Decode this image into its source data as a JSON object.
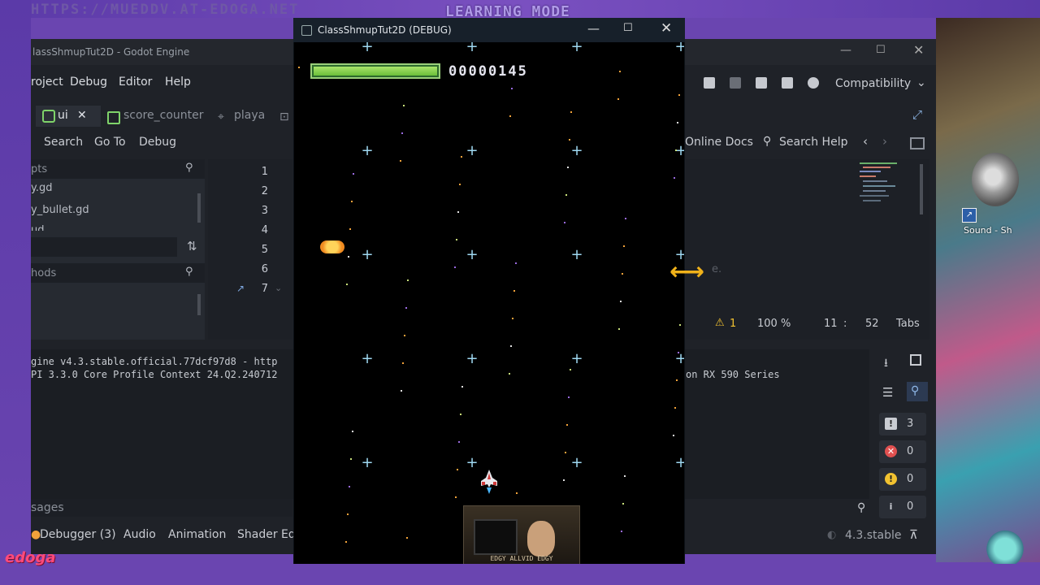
{
  "overlay": {
    "url_text": "HTTPS://MUEDDV.AT-EDOGA.NET",
    "mode_text": "LEARNING MODE",
    "logo_text": "edoga"
  },
  "desktop": {
    "icon_label": "Sound - Sh"
  },
  "editor": {
    "title": "lassShmupTut2D - Godot Engine",
    "menu": [
      "roject",
      "Debug",
      "Editor",
      "Help"
    ],
    "renderer": "Compatibility",
    "tabs": [
      {
        "label": "ui",
        "close": "✕"
      },
      {
        "label": "score_counter"
      },
      {
        "label": "playa"
      }
    ],
    "script_menu": [
      "Search",
      "Go To",
      "Debug"
    ],
    "docs": {
      "online": "Online Docs",
      "search_help": "Search Help"
    },
    "left_panel": {
      "filter1_placeholder": "pts",
      "files": [
        "y.gd",
        "y_bullet.gd",
        "ud"
      ],
      "filter2_placeholder": "hods"
    },
    "line_numbers": [
      "1",
      "2",
      "3",
      "4",
      "5",
      "6",
      "7"
    ],
    "status": {
      "warnings": "1",
      "zoom": "100 %",
      "line": "11",
      "sep": ":",
      "col": "52",
      "indent": "Tabs"
    },
    "faded_text": "e.",
    "output_lines": [
      "gine v4.3.stable.official.77dcf97d8 - http",
      "PI 3.3.0 Core Profile Context 24.Q2.240712"
    ],
    "output_right": "on RX 590 Series",
    "output_filter_placeholder": "sages",
    "counters": {
      "messages": "3",
      "errors": "0",
      "warnings": "0",
      "info": "0"
    },
    "bottom_tabs": [
      "Debugger (3)",
      "Audio",
      "Animation",
      "Shader Ed"
    ],
    "version": "4.3.stable"
  },
  "game_window": {
    "title": "ClassShmupTut2D (DEBUG)",
    "score": "00000145",
    "health_fraction": 1.0,
    "webcam_caption": "EDGY  ALLVID EDGY"
  },
  "colors": {
    "frame": "#6a45b0",
    "editor_bg": "#1f2228",
    "health": "#8ad24a",
    "accent_warning": "#f2c230",
    "accent_error": "#e05050"
  }
}
